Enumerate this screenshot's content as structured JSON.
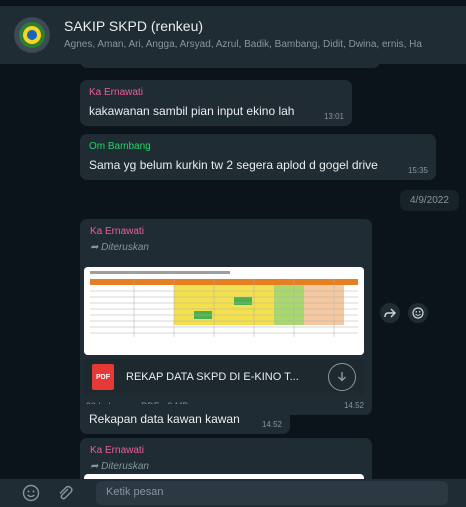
{
  "header": {
    "group_name": "SAKIP SKPD (renkeu)",
    "participants": "Agnes, Aman, Ari, Angga, Arsyad, Azrul, Badik, Bambang, Didit, Dwina, ernis, Ha"
  },
  "messages": [
    {
      "sender": "Ka Ernawati",
      "sender_color": "#ea5f9c",
      "text": "kakawanan sambil pian input ekino lah",
      "time": "13:01"
    },
    {
      "sender": "Om Bambang",
      "sender_color": "#25d366",
      "text": "Sama yg belum kurkin tw 2 segera aplod d gogel drive",
      "time": "15:35"
    }
  ],
  "date_chip": "4/9/2022",
  "forwarded_doc": {
    "sender": "Ka Ernawati",
    "sender_color": "#ea5f9c",
    "forwarded_label": "Diteruskan",
    "file_type": "PDF",
    "file_name": "REKAP DATA SKPD DI E-KINO T...",
    "meta": "20 halaman • PDF • 2 MB",
    "time": "14.52"
  },
  "caption_message": {
    "text": "Rekapan data kawan kawan",
    "time": "14.52"
  },
  "forwarded_next": {
    "sender": "Ka Ernawati",
    "sender_color": "#ea5f9c",
    "forwarded_label": "Diteruskan"
  },
  "composer": {
    "placeholder": "Ketik pesan"
  },
  "colors": {
    "background": "#0b141a",
    "bubble": "#202c33",
    "header": "#202c33",
    "pdf_red": "#e53935"
  }
}
